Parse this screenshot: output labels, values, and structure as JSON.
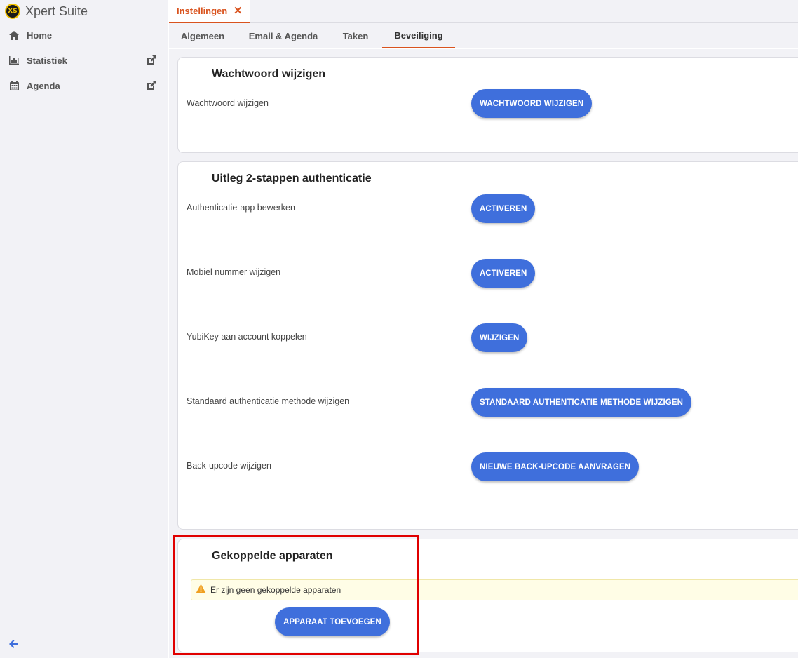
{
  "app": {
    "title": "Xpert Suite",
    "logo_text": "XS"
  },
  "sidebar": {
    "items": [
      {
        "label": "Home",
        "icon": "home-icon"
      },
      {
        "label": "Statistiek",
        "icon": "bar-chart-icon",
        "external": true
      },
      {
        "label": "Agenda",
        "icon": "calendar-icon",
        "external": true
      }
    ],
    "collapse_icon": "arrow-left-icon"
  },
  "open_tab": {
    "label": "Instellingen",
    "close": "✕"
  },
  "subtabs": [
    {
      "label": "Algemeen"
    },
    {
      "label": "Email & Agenda"
    },
    {
      "label": "Taken"
    },
    {
      "label": "Beveiliging",
      "active": true
    }
  ],
  "password_card": {
    "title": "Wachtwoord wijzigen",
    "row_label": "Wachtwoord wijzigen",
    "button": "WACHTWOORD WIJZIGEN"
  },
  "twofa_card": {
    "title": "Uitleg 2-stappen authenticatie",
    "rows": [
      {
        "label": "Authenticatie-app bewerken",
        "button": "ACTIVEREN"
      },
      {
        "label": "Mobiel nummer wijzigen",
        "button": "ACTIVEREN"
      },
      {
        "label": "YubiKey aan account koppelen",
        "button": "WIJZIGEN"
      },
      {
        "label": "Standaard authenticatie methode wijzigen",
        "button": "STANDAARD AUTHENTICATIE METHODE WIJZIGEN"
      },
      {
        "label": "Back-upcode wijzigen",
        "button": "NIEUWE BACK-UPCODE AANVRAGEN"
      }
    ]
  },
  "devices_card": {
    "title": "Gekoppelde apparaten",
    "warning": "Er zijn geen gekoppelde apparaten",
    "button": "APPARAAT TOEVOEGEN"
  },
  "colors": {
    "accent": "#d9531e",
    "button": "#3f6fdc",
    "warning_bg": "#fffde6",
    "highlight": "#e00000"
  }
}
